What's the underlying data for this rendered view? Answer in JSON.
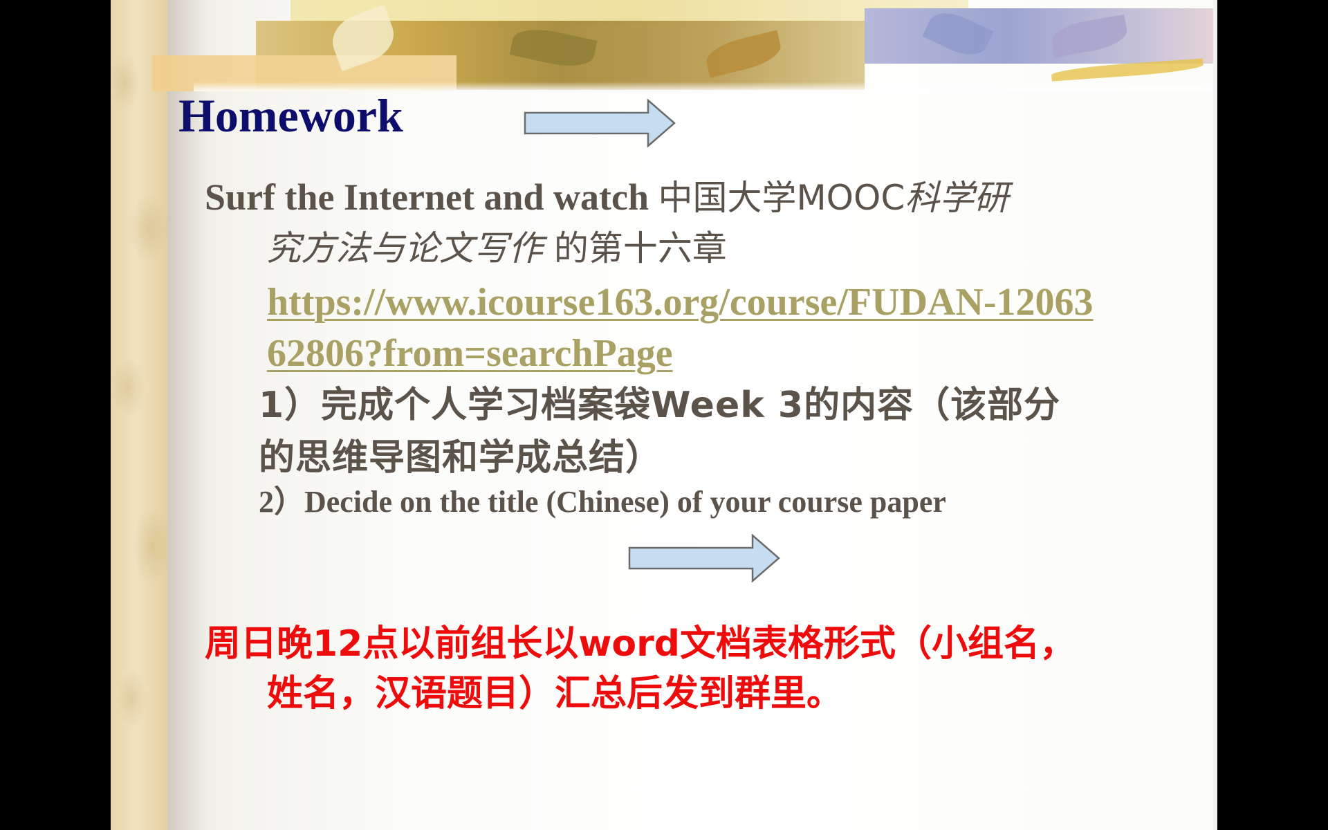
{
  "slide": {
    "title": "Homework",
    "surf_line": {
      "prefix": "Surf the Internet and watch ",
      "cn_platform": "中国大学MOOC",
      "italic_course_a": "科学研",
      "italic_course_b": "究方法与论文写作",
      "chapter": " 的第十六章"
    },
    "link": {
      "text": "https://www.icourse163.org/course/FUDAN-1206362806?from=searchPage"
    },
    "task_1": "1）完成个人学习档案袋Week 3的内容（该部分的思维导图和学成总结）",
    "task_2": "2）Decide on the title (Chinese) of your course paper",
    "notice": {
      "line1": "周日晚12点以前组长以word文档表格形式（小组名，",
      "line2": "姓名，汉语题目）汇总后发到群里。"
    }
  },
  "colors": {
    "title": "#0d0d6b",
    "body": "#5b524a",
    "link": "#a9a163",
    "notice": "#ee0b0b",
    "arrow_fill": "#c6dcf0",
    "arrow_stroke": "#6b6b6b"
  }
}
